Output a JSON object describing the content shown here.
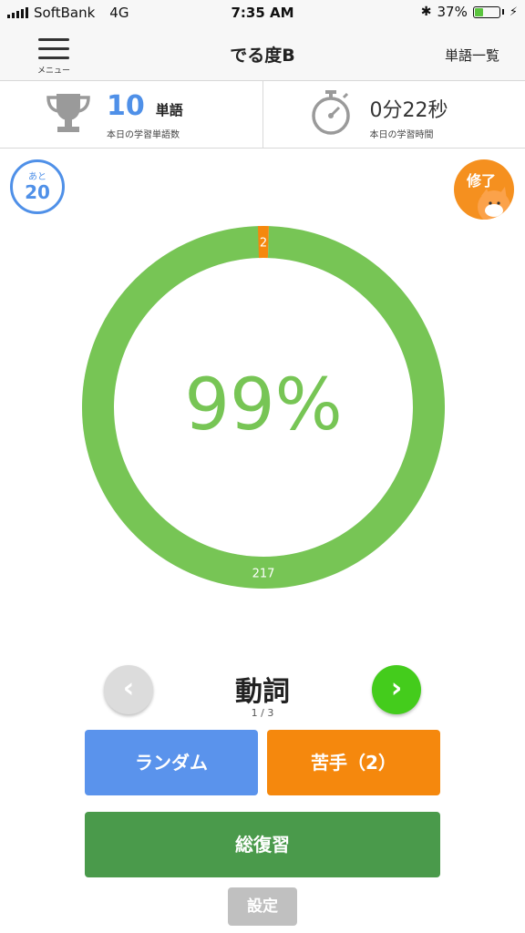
{
  "status_bar": {
    "carrier": "SoftBank",
    "network": "4G",
    "time": "7:35 AM",
    "battery": "37%",
    "battery_level": 0.37
  },
  "nav": {
    "menu_label": "メニュー",
    "title": "でる度B",
    "word_list": "単語一覧"
  },
  "stats": {
    "words_count": "10",
    "words_unit": "単語",
    "words_caption": "本日の学習単語数",
    "time_value": "0分22秒",
    "time_caption": "本日の学習時間"
  },
  "remaining": {
    "prefix": "あと",
    "count": "20"
  },
  "done_badge": "修了",
  "progress": {
    "percent_label": "99%",
    "known": 217,
    "weak": 2,
    "known_label": "217",
    "weak_label": "2",
    "colors": {
      "known": "#77c555",
      "weak": "#f5880d"
    }
  },
  "category": {
    "title": "動詞",
    "page": "1 / 3"
  },
  "buttons": {
    "random": "ランダム",
    "weak": "苦手（2）",
    "review": "総復習",
    "settings": "設定"
  }
}
